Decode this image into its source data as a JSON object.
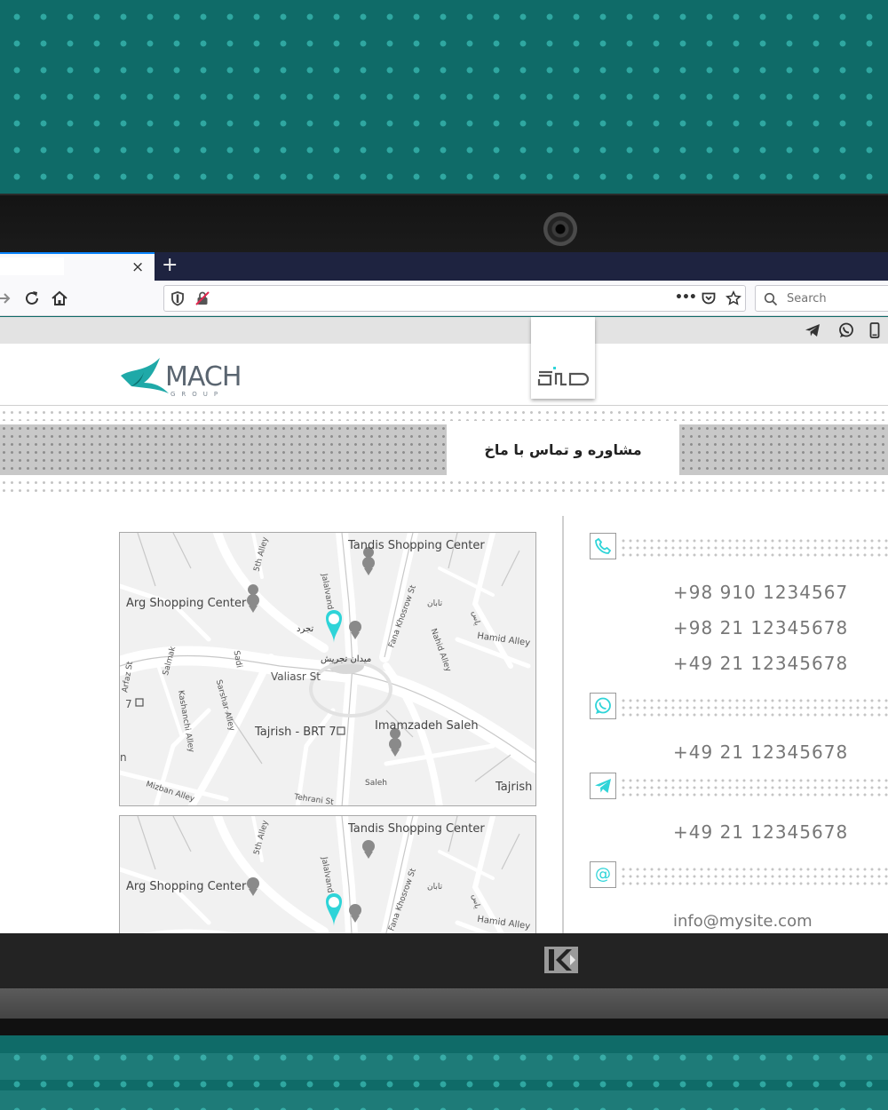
{
  "browser": {
    "tab_close": "×",
    "new_tab": "+",
    "search_placeholder": "Search",
    "url_actions": "•••"
  },
  "site": {
    "brand_name": "MACH",
    "brand_sub": "GROUP",
    "banner_title": "مشاوره و تماس با ماخ"
  },
  "map": {
    "labels": {
      "tandis": "Tandis Shopping Center",
      "arg": "Arg Shopping Center",
      "fifth_alley": "5th Alley",
      "jalalvand": "Jalalvand",
      "fana_khosrow": "Fana Khosrow St",
      "nahid_alley": "Nahid Alley",
      "hamid_alley": "Hamid Alley",
      "salmak": "Salmak",
      "sadi": "Sadi",
      "valiasr": "Valiasr St",
      "arfaz": "Arfaz St",
      "seven": "7",
      "kashanchi": "Kashanchi Alley",
      "sarshar": "Sarshar Alley",
      "tajrish_brt": "Tajrish - BRT 7",
      "imamzadeh": "Imamzadeh Saleh",
      "saleh": "Saleh",
      "tajrish": "Tajrish",
      "mizban": "Mizban Alley",
      "tehrani": "Tehrani St",
      "n": "n",
      "farsi_square": "میدان تجریش",
      "farsi_name": "تجرد",
      "farsi_a": "تابان",
      "farsi_b": "یاس"
    }
  },
  "contact": {
    "phones": [
      "+98 910 1234567",
      "+98 21 12345678",
      "+49 21 12345678"
    ],
    "whatsapp": "+49 21 12345678",
    "telegram": "+49 21 12345678",
    "email": "info@mysite.com",
    "email_icon_glyph": "@"
  },
  "colors": {
    "accent": "#2fd4d8",
    "teal_bg": "#0f6b68",
    "pin": "#2fd4d8"
  }
}
